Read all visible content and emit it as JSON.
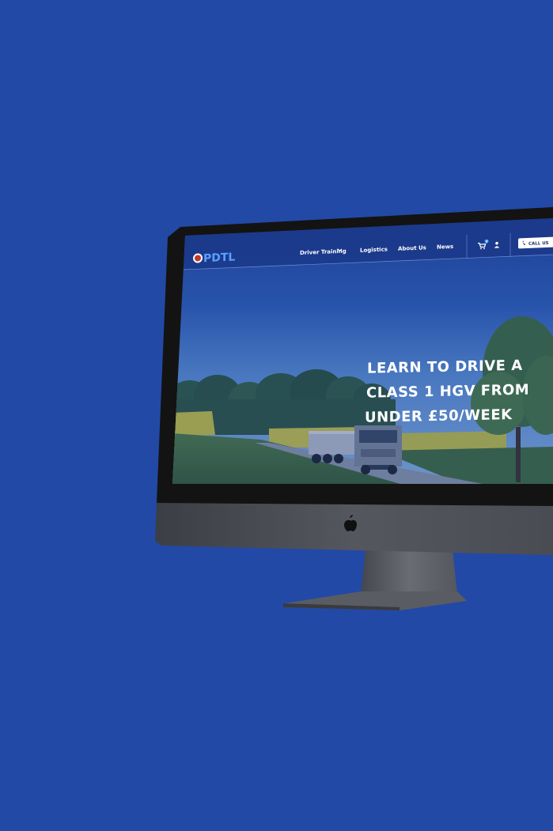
{
  "colors": {
    "background": "#2249a6",
    "bezel": "#141414",
    "chin": "#4a4c54",
    "stand": "#5c5e66",
    "site_header": "#1c3a8a",
    "accent": "#2a8cff"
  },
  "site": {
    "logo": "PDTL",
    "nav": {
      "driver_training": "Driver Training",
      "logistics": "Logistics",
      "about_us": "About Us",
      "news": "News"
    },
    "cart_count": "0",
    "call_button": "CALL US",
    "hero": {
      "line1": "LEARN TO DRIVE A",
      "line2": "CLASS 1 HGV FROM",
      "line3": "UNDER £50/WEEK"
    }
  },
  "icons": {
    "logo_badge": "shield-emblem-icon",
    "dropdown": "chevron-down-icon",
    "cart": "cart-icon",
    "account": "user-icon",
    "phone": "phone-icon",
    "brand": "apple-logo-icon"
  }
}
